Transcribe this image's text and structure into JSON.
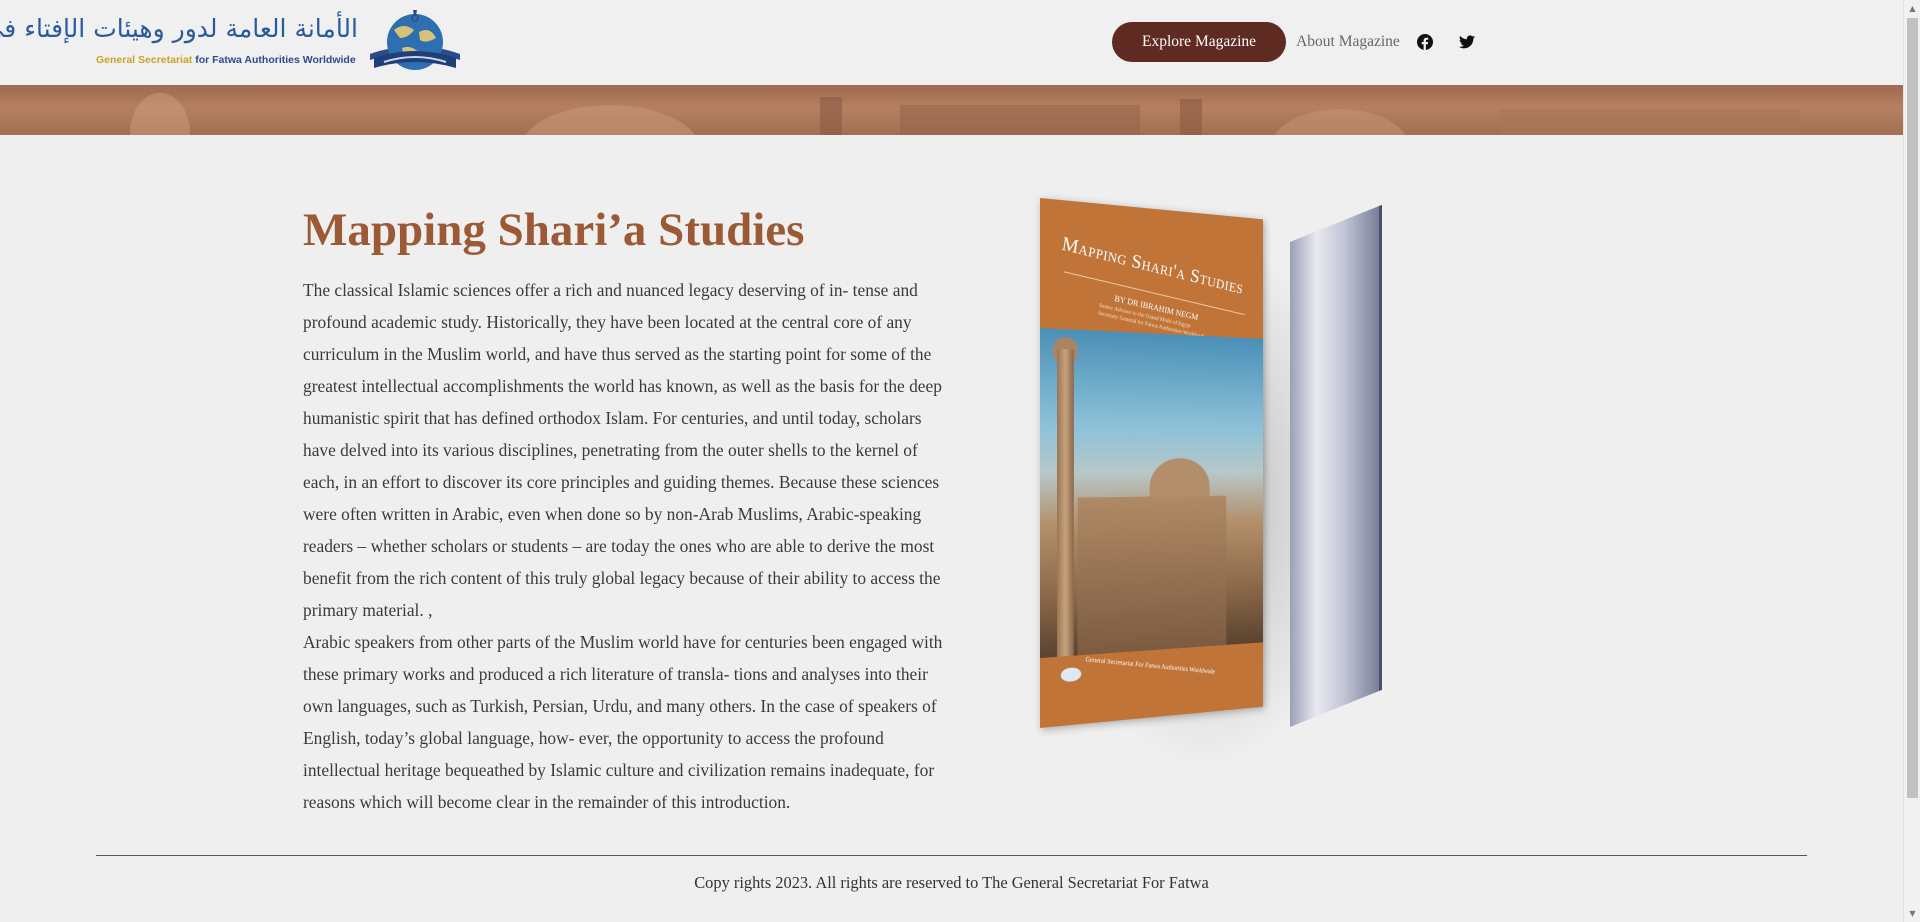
{
  "header": {
    "logo_arabic": "الأمانة العامة لدور وهيئات الإفتاء في العالم",
    "logo_english_gold": "General Secretariat",
    "logo_english_rest": " for Fatwa Authorities Worldwide",
    "explore_label": "Explore Magazine",
    "about_label": "About Magazine",
    "social": [
      {
        "icon": "facebook-icon"
      },
      {
        "icon": "twitter-icon"
      }
    ]
  },
  "main": {
    "title": "Mapping Shari’a Studies",
    "paragraphs": [
      "The classical Islamic sciences offer a rich and nuanced legacy deserving of in- tense and profound academic study. Historically, they have been located at the central core of any curriculum in the Muslim world, and have thus served as the starting point for some of the greatest intellectual accomplishments the world has known, as well as the basis for the deep humanistic spirit that has defined orthodox Islam. For centuries, and until today, scholars have delved into its various disciplines, penetrating from the outer shells to the kernel of each, in an effort to discover its core principles and guiding themes. Because these sciences were often written in Arabic, even when done so by non-Arab Muslims, Arabic-speaking readers – whether scholars or students – are today the ones who are able to derive the most benefit from the rich content of this truly global legacy because of their ability to access the primary material. ,",
      "Arabic speakers from other parts of the Muslim world have for centuries been engaged with these primary works and produced a rich literature of transla- tions and analyses into their own languages, such as Turkish, Persian, Urdu, and many others. In the case of speakers of English, today’s global language, how- ever, the opportunity to access the profound intellectual heritage bequeathed by Islamic culture and civilization remains inadequate, for reasons which will become clear in the remainder of this introduction."
    ]
  },
  "book": {
    "cover_title": "Mapping Shari'a Studies",
    "cover_author": "BY DR IBRAHIM NEGM",
    "cover_subtitle_1": "Senior Advisor to the Grand Mufti of Egypt",
    "cover_subtitle_2": "Secretary General for Fatwa Authorities Worldwide",
    "cover_footer": "General Secretariat For Fatwa Authorities Worldwide",
    "cover_colors": {
      "cover": "#c07438",
      "pages": "#e8e9f0"
    }
  },
  "footer": {
    "copyright": "Copy rights 2023. All rights are reserved to The General Secretariat For Fatwa"
  },
  "colors": {
    "title": "#9b5a35",
    "explore_button": "#5f2a21",
    "background": "#efefef"
  }
}
